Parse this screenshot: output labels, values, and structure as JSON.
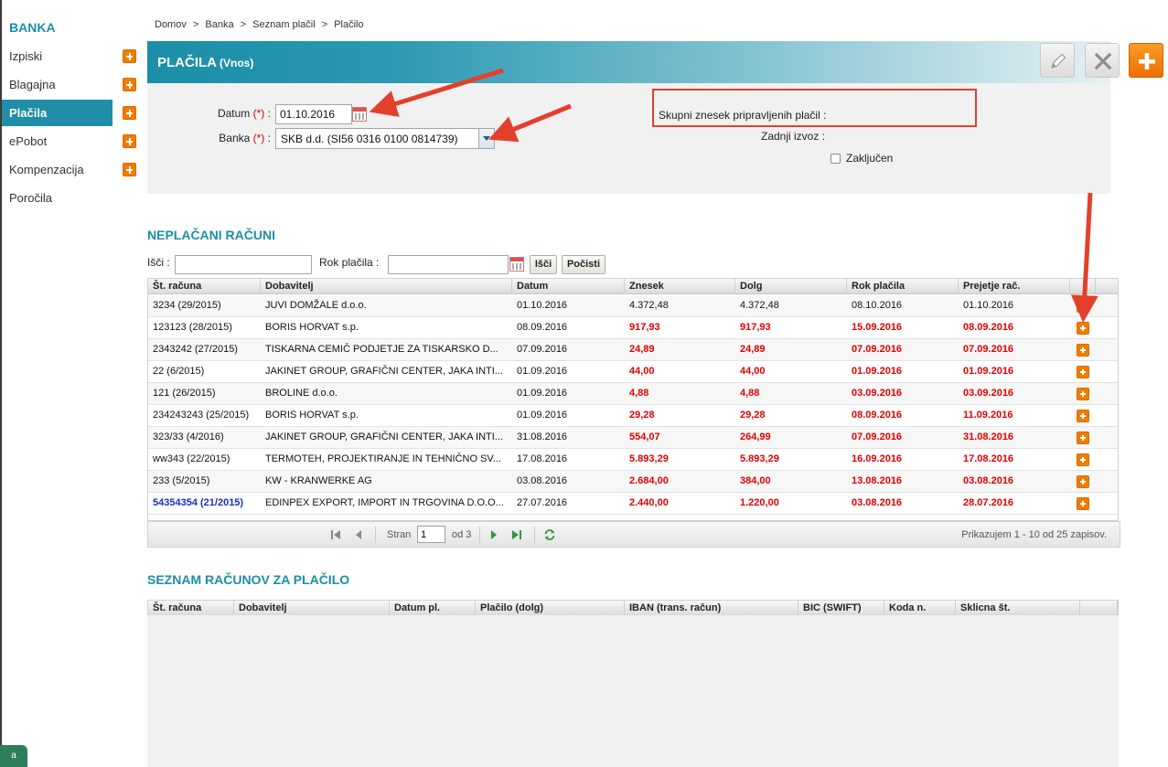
{
  "sidebar": {
    "title": "BANKA",
    "items": [
      {
        "label": "Izpiski",
        "plus": true
      },
      {
        "label": "Blagajna",
        "plus": true
      },
      {
        "label": "Plačila",
        "plus": true,
        "active": true
      },
      {
        "label": "ePobot",
        "plus": true
      },
      {
        "label": "Kompenzacija",
        "plus": true
      },
      {
        "label": "Poročila",
        "plus": false
      }
    ],
    "bottom_tab": "a"
  },
  "breadcrumb": [
    "Domov",
    ">",
    "Banka",
    ">",
    "Seznam plačil",
    ">",
    "Plačilo"
  ],
  "header": {
    "title": "PLAČILA",
    "subtitle": "(Vnos)"
  },
  "toolbar": {
    "edit_icon": "pencil-icon",
    "cancel_icon": "close-icon",
    "add_icon": "plus-icon"
  },
  "form": {
    "datum_label": "Datum",
    "banka_label": "Banka",
    "required_mark": "(*)",
    "colon": ":",
    "datum_value": "01.10.2016",
    "banka_value": "SKB d.d. (SI56 0316 0100 0814739)",
    "skupni_label": "Skupni znesek pripravljenih plačil :",
    "zadnji_label": "Zadnji izvoz :",
    "zakljucen_label": "Zaključen"
  },
  "unpaid": {
    "title": "NEPLAČANI RAČUNI",
    "search_label": "Išči :",
    "due_label": "Rok plačila :",
    "search_button": "Išči",
    "clear_button": "Počisti",
    "columns": [
      "Št. računa",
      "Dobavitelj",
      "Datum",
      "Znesek",
      "Dolg",
      "Rok plačila",
      "Prejetje rač."
    ],
    "rows": [
      {
        "num": "3234 (29/2015)",
        "supplier": "JUVI DOMŽALE d.o.o.",
        "date": "01.10.2016",
        "amount": "4.372,48",
        "debt": "4.372,48",
        "due": "08.10.2016",
        "received": "01.10.2016",
        "overdue": false,
        "link": false
      },
      {
        "num": "123123 (28/2015)",
        "supplier": "BORIS HORVAT s.p.",
        "date": "08.09.2016",
        "amount": "917,93",
        "debt": "917,93",
        "due": "15.09.2016",
        "received": "08.09.2016",
        "overdue": true,
        "link": false
      },
      {
        "num": "2343242 (27/2015)",
        "supplier": "TISKARNA CEMIČ PODJETJE ZA TISKARSKO D...",
        "date": "07.09.2016",
        "amount": "24,89",
        "debt": "24,89",
        "due": "07.09.2016",
        "received": "07.09.2016",
        "overdue": true,
        "link": false
      },
      {
        "num": "22 (6/2015)",
        "supplier": "JAKINET GROUP, GRAFIČNI CENTER, JAKA INTI...",
        "date": "01.09.2016",
        "amount": "44,00",
        "debt": "44,00",
        "due": "01.09.2016",
        "received": "01.09.2016",
        "overdue": true,
        "link": false
      },
      {
        "num": "121 (26/2015)",
        "supplier": "BROLINE d.o.o.",
        "date": "01.09.2016",
        "amount": "4,88",
        "debt": "4,88",
        "due": "03.09.2016",
        "received": "03.09.2016",
        "overdue": true,
        "link": false
      },
      {
        "num": "234243243 (25/2015)",
        "supplier": "BORIS HORVAT s.p.",
        "date": "01.09.2016",
        "amount": "29,28",
        "debt": "29,28",
        "due": "08.09.2016",
        "received": "11.09.2016",
        "overdue": true,
        "link": false
      },
      {
        "num": "323/33 (4/2016)",
        "supplier": "JAKINET GROUP, GRAFIČNI CENTER, JAKA INTI...",
        "date": "31.08.2016",
        "amount": "554,07",
        "debt": "264,99",
        "due": "07.09.2016",
        "received": "31.08.2016",
        "overdue": true,
        "link": false
      },
      {
        "num": "ww343 (22/2015)",
        "supplier": "TERMOTEH, PROJEKTIRANJE IN TEHNIČNO SV...",
        "date": "17.08.2016",
        "amount": "5.893,29",
        "debt": "5.893,29",
        "due": "16.09.2016",
        "received": "17.08.2016",
        "overdue": true,
        "link": false
      },
      {
        "num": "233 (5/2015)",
        "supplier": "KW - KRANWERKE AG",
        "date": "03.08.2016",
        "amount": "2.684,00",
        "debt": "384,00",
        "due": "13.08.2016",
        "received": "03.08.2016",
        "overdue": true,
        "link": false
      },
      {
        "num": "54354354 (21/2015)",
        "supplier": "EDINPEX EXPORT, IMPORT IN TRGOVINA D.O.O...",
        "date": "27.07.2016",
        "amount": "2.440,00",
        "debt": "1.220,00",
        "due": "03.08.2016",
        "received": "28.07.2016",
        "overdue": true,
        "link": true
      }
    ],
    "pager": {
      "page_label": "Stran",
      "page_value": "1",
      "of_label": "od 3",
      "summary": "Prikazujem 1 - 10 od 25 zapisov."
    }
  },
  "to_pay": {
    "title": "SEZNAM RAČUNOV ZA PLAČILO",
    "columns": [
      "Št. računa",
      "Dobavitelj",
      "Datum pl.",
      "Plačilo (dolg)",
      "IBAN (trans. račun)",
      "BIC (SWIFT)",
      "Koda n.",
      "Sklicna št."
    ]
  },
  "colors": {
    "accent": "#1b8fa8",
    "overdue": "#e00000",
    "plus": "#f07c00",
    "annotation": "#e3402b"
  }
}
